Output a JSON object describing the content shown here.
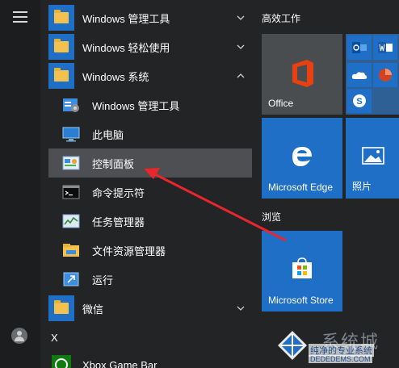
{
  "start_menu": {
    "app_list": [
      {
        "label": "Windows 管理工具",
        "type": "folder",
        "expanded": false
      },
      {
        "label": "Windows 轻松使用",
        "type": "folder",
        "expanded": false
      },
      {
        "label": "Windows 系统",
        "type": "folder",
        "expanded": true
      },
      {
        "label": "Windows 管理工具",
        "type": "app",
        "icon": "admin-tools-icon"
      },
      {
        "label": "此电脑",
        "type": "app",
        "icon": "this-pc-icon"
      },
      {
        "label": "控制面板",
        "type": "app",
        "icon": "control-panel-icon",
        "selected": true
      },
      {
        "label": "命令提示符",
        "type": "app",
        "icon": "cmd-icon"
      },
      {
        "label": "任务管理器",
        "type": "app",
        "icon": "task-manager-icon"
      },
      {
        "label": "文件资源管理器",
        "type": "app",
        "icon": "file-explorer-icon"
      },
      {
        "label": "运行",
        "type": "app",
        "icon": "run-icon"
      },
      {
        "label": "微信",
        "type": "folder",
        "expanded": false
      },
      {
        "label": "Xbox Game Bar",
        "type": "app",
        "icon": "xbox-game-bar-icon"
      }
    ],
    "section_letter": "X"
  },
  "tiles": {
    "group1_title": "高效工作",
    "group2_title": "浏览",
    "office": "Office",
    "edge": "Microsoft Edge",
    "photos": "照片",
    "store": "Microsoft Store"
  },
  "watermark": {
    "title": "系统城",
    "subtitle": "纯净的专业系统",
    "url": "DEDEDEMS.COM"
  },
  "colors": {
    "accent": "#1f6fc6",
    "background": "#222426",
    "selected_row": "#4d4f52",
    "arrow": "#e8262b"
  }
}
